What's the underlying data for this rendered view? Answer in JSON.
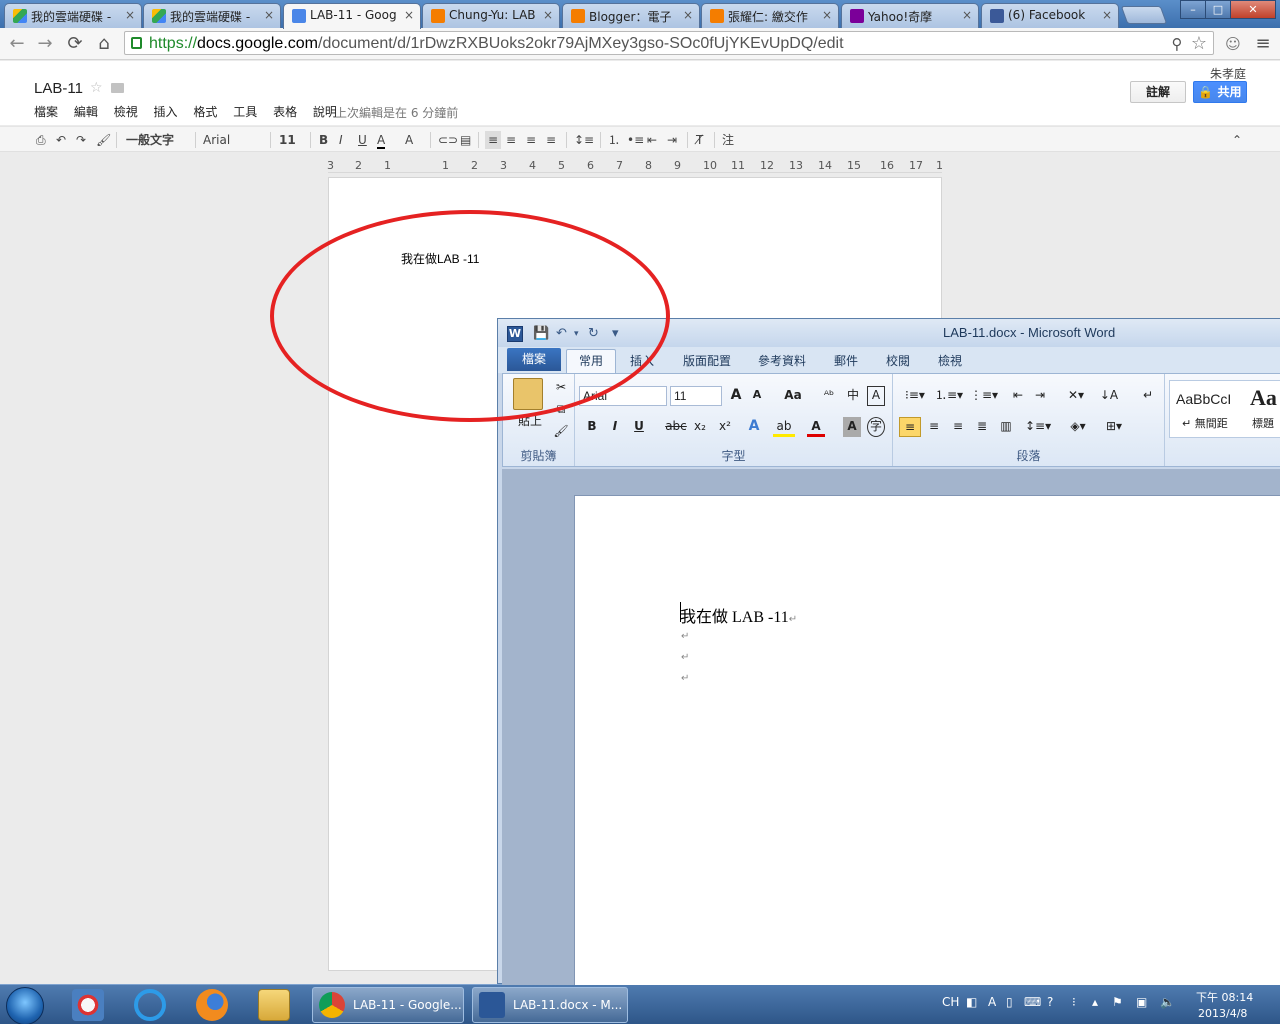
{
  "browser": {
    "tabs": [
      {
        "label": "我的雲端硬碟 -",
        "favicon": "google-drive-icon",
        "active": false
      },
      {
        "label": "我的雲端硬碟 -",
        "favicon": "google-drive-icon",
        "active": false
      },
      {
        "label": "LAB-11 - Goog",
        "favicon": "google-docs-icon",
        "active": true
      },
      {
        "label": "Chung-Yu: LAB",
        "favicon": "blogger-icon",
        "active": false
      },
      {
        "label": "Blogger：電子",
        "favicon": "blogger-icon",
        "active": false
      },
      {
        "label": "張耀仁: 繳交作",
        "favicon": "blogger-icon",
        "active": false
      },
      {
        "label": "Yahoo!奇摩",
        "favicon": "yahoo-icon",
        "active": false
      },
      {
        "label": "(6) Facebook",
        "favicon": "facebook-icon",
        "active": false
      }
    ],
    "close_glyph": "×",
    "url_scheme": "https://",
    "url_host": "docs.google.com",
    "url_path": "/document/d/1rDwzRXBUoks2okr79AjMXey3gso-SOc0fUjYKEvUpDQ/edit"
  },
  "gdocs": {
    "title": "LAB-11",
    "menu": [
      "檔案",
      "編輯",
      "檢視",
      "插入",
      "格式",
      "工具",
      "表格",
      "說明"
    ],
    "last_edit": "上次編輯是在 6 分鐘前",
    "user_name": "朱孝庭",
    "comments_label": "註解",
    "share_label": "共用",
    "toolbar": {
      "style": "一般文字",
      "font": "Arial",
      "size": "11",
      "more": "注"
    },
    "ruler": [
      "3",
      "2",
      "1",
      "1",
      "2",
      "3",
      "4",
      "5",
      "6",
      "7",
      "8",
      "9",
      "10",
      "11",
      "12",
      "13",
      "14",
      "15",
      "16",
      "17",
      "1"
    ],
    "body_text": "我在做LAB -11"
  },
  "word": {
    "window_title": "LAB-11.docx - Microsoft Word",
    "tabs": {
      "file": "檔案",
      "home": "常用",
      "insert": "插入",
      "layout": "版面配置",
      "references": "參考資料",
      "mailings": "郵件",
      "review": "校閱",
      "view": "檢視"
    },
    "ribbon": {
      "paste_label": "貼上",
      "clipboard_group": "剪貼簿",
      "font_group": "字型",
      "paragraph_group": "段落",
      "font_name": "Arial",
      "font_size": "11",
      "grow_font": "A",
      "shrink_font": "A",
      "change_case": "Aa",
      "bold": "B",
      "italic": "I",
      "underline": "U",
      "strikethrough": "abc",
      "subscript": "x₂",
      "superscript": "x²",
      "style_preview_1": "AaBbCcI",
      "style_name_1": "↵ 無間距",
      "style_preview_2": "Aa",
      "style_name_2": "標題"
    },
    "document_text": "我在做 LAB -11",
    "para_mark": "↵"
  },
  "taskbar": {
    "buttons": [
      {
        "label": "LAB-11 - Google...",
        "icon": "chrome-icon"
      },
      {
        "label": "LAB-11.docx - M...",
        "icon": "word-icon"
      }
    ],
    "ime": "CH",
    "time": "下午 08:14",
    "date": "2013/4/8"
  }
}
